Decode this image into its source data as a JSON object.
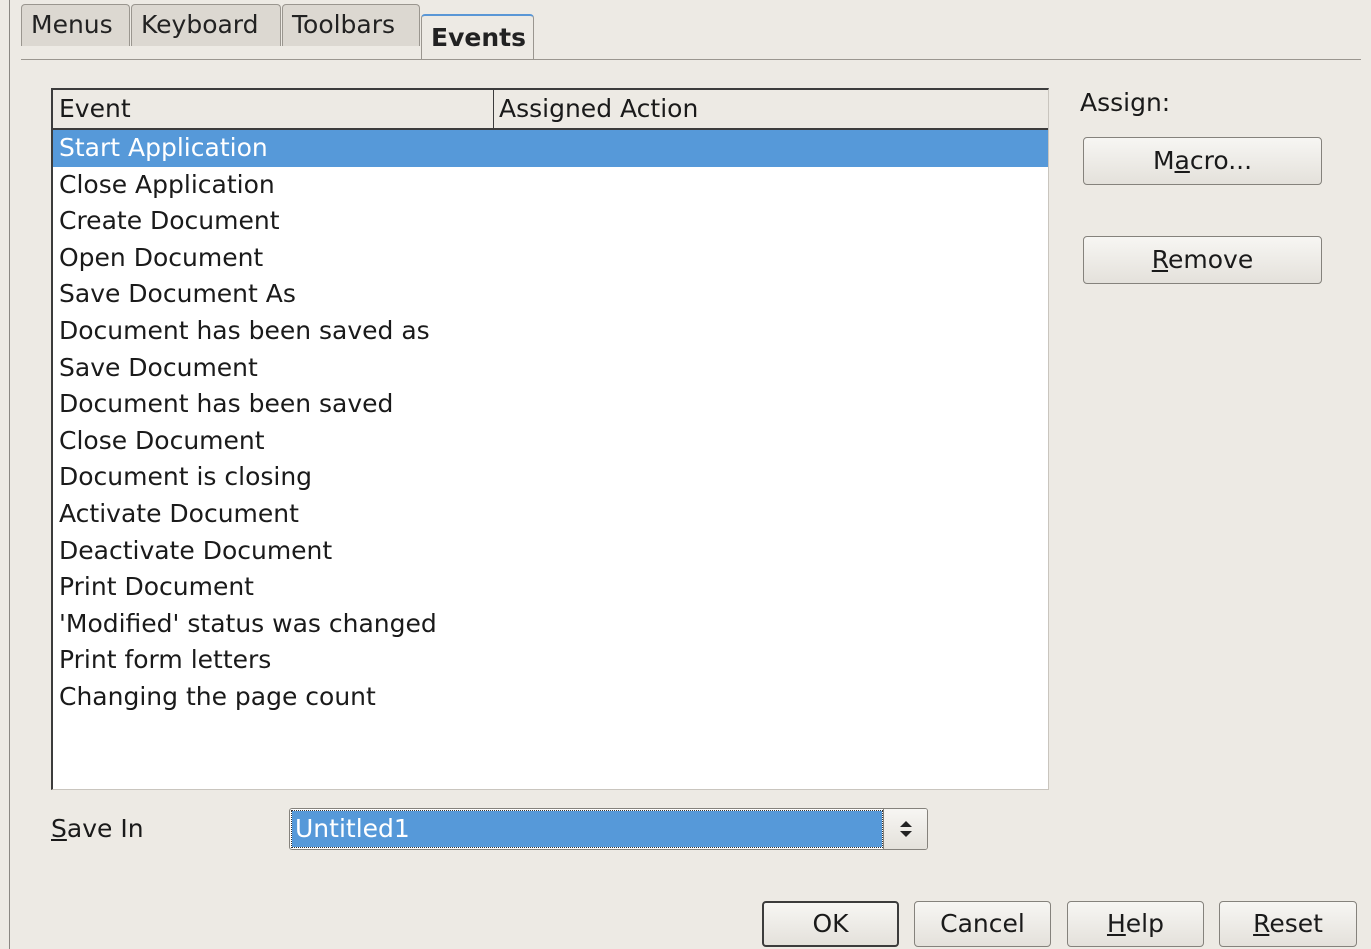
{
  "tabs": [
    "Menus",
    "Keyboard",
    "Toolbars",
    "Events"
  ],
  "active_tab": "Events",
  "list": {
    "columns": [
      "Event",
      "Assigned Action"
    ],
    "selected_index": 0,
    "rows": [
      "Start Application",
      "Close Application",
      "Create Document",
      "Open Document",
      "Save Document As",
      "Document has been saved as",
      "Save Document",
      "Document has been saved",
      "Close Document",
      "Document is closing",
      "Activate Document",
      "Deactivate Document",
      "Print Document",
      "'Modified' status was changed",
      "Print form letters",
      "Changing the page count"
    ]
  },
  "assign": {
    "label": "Assign:",
    "macro": {
      "pre": "M",
      "mnemonic": "a",
      "post": "cro..."
    },
    "remove": {
      "pre": "",
      "mnemonic": "R",
      "post": "emove"
    }
  },
  "save_in": {
    "label": {
      "pre": "",
      "mnemonic": "S",
      "post": "ave In"
    },
    "value": "Untitled1"
  },
  "buttons": {
    "ok": "OK",
    "cancel": "Cancel",
    "help": {
      "pre": "",
      "mnemonic": "H",
      "post": "elp"
    },
    "reset": {
      "pre": "",
      "mnemonic": "R",
      "post": "eset"
    }
  },
  "colors": {
    "selection": "#5699d9",
    "background": "#edeae4",
    "tab_accent": "#5a97d6"
  }
}
